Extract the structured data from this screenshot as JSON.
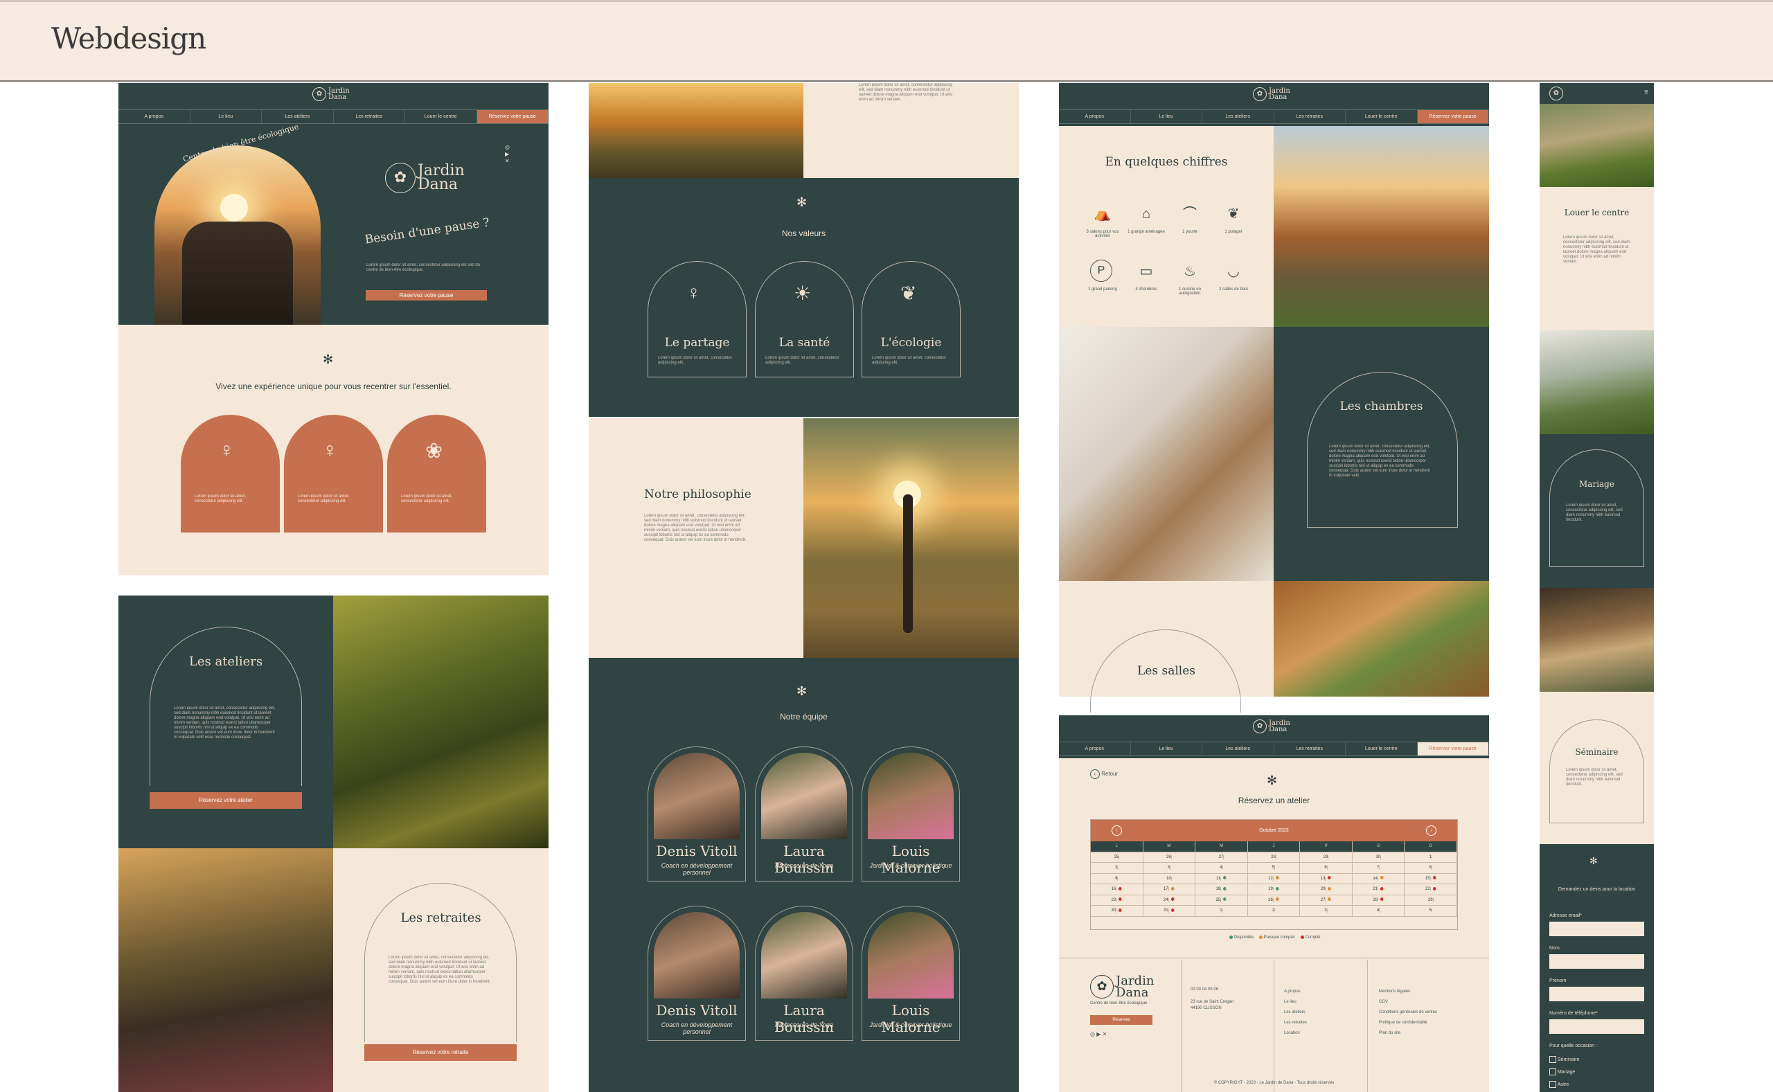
{
  "header": {
    "title": "Webdesign"
  },
  "colors": {
    "dark": "#2f4443",
    "cream": "#f5e8d9",
    "terracotta": "#c7704f",
    "header_bg": "#f5ebe1"
  },
  "nav": {
    "items": [
      "A propos",
      "Le lieu",
      "Les ateliers",
      "Les retraites",
      "Louer le centre",
      "Réservez votre pause"
    ]
  },
  "logo": {
    "line1": "Jardin",
    "line2": "Dana",
    "tagline": "Centre de bien-être écologique"
  },
  "col1": {
    "hero_arc_text": "Centre de bien être écologique",
    "hero_title": "Besoin d'une pause ?",
    "hero_button": "Réservez votre pause",
    "intro_text": "Vivez une expérience unique pour vous recentrer sur l'essentiel.",
    "ateliers_title": "Les ateliers",
    "ateliers_button": "Réservez votre atelier",
    "retraites_title": "Les retraites",
    "retraites_button": "Réservez votre retraite"
  },
  "col2": {
    "values_title": "Nos valeurs",
    "values": [
      "Le partage",
      "La santé",
      "L'écologie"
    ],
    "philo_title": "Notre philosophie",
    "team_title": "Notre équipe",
    "team": [
      {
        "name": "Denis Vitoll",
        "role": "Coach en développement personnel"
      },
      {
        "name": "Laura Bouissin",
        "role": "Professeure de Yoga"
      },
      {
        "name": "Louis Malorne",
        "role": "Jardinier & cuisinier holistique"
      },
      {
        "name": "Denis Vitoll",
        "role": "Coach en développement personnel"
      },
      {
        "name": "Laura Bouissin",
        "role": "Professeure de Yoga"
      },
      {
        "name": "Louis Malorne",
        "role": "Jardinier & cuisinier holistique"
      }
    ]
  },
  "col3": {
    "figures_title": "En quelques chiffres",
    "figures": [
      "3 salons pour vos activités",
      "1 grange aménagée",
      "1 yourte",
      "1 potager",
      "1 grand parking",
      "4 chambres",
      "1 cuisine en autogestion",
      "2 salles de bain"
    ],
    "figure_icons": [
      "tent-icon",
      "barn-icon",
      "yurt-icon",
      "plant-icon",
      "parking-icon",
      "bed-icon",
      "chef-hat-icon",
      "bath-icon"
    ],
    "rooms_title": "Les chambres",
    "halls_title": "Les salles",
    "booking_back": "Retour",
    "booking_title": "Réservez un atelier",
    "calendar_month": "Octobre 2023",
    "calendar_days": [
      "L",
      "M",
      "M",
      "J",
      "V",
      "S",
      "D"
    ],
    "calendar_rows": [
      [
        "25",
        "26",
        "27",
        "28",
        "29",
        "30",
        "1"
      ],
      [
        "2",
        "3",
        "4",
        "5",
        "6",
        "7",
        "8"
      ],
      [
        "9",
        "10",
        "11",
        "12",
        "13",
        "14",
        "15"
      ],
      [
        "16",
        "17",
        "18",
        "19",
        "20",
        "21",
        "22"
      ],
      [
        "23",
        "24",
        "25",
        "26",
        "27",
        "28",
        "29"
      ],
      [
        "30",
        "31",
        "1",
        "2",
        "3",
        "4",
        "5"
      ]
    ],
    "legend": [
      "Disponible",
      "Presque complet",
      "Complet"
    ],
    "footer_button": "Réservez",
    "footer_phone": "02 03 04 05 06",
    "footer_address1": "23 rue de Saint Cregan",
    "footer_address2": "44190 CLISSON",
    "footer_links1": [
      "A propos",
      "Le lieu",
      "Les ateliers",
      "Les retraites",
      "Location"
    ],
    "footer_links2": [
      "Mentions légales",
      "CGV",
      "Conditions générales de ventes",
      "Politique de confidentialité",
      "Plan du site"
    ],
    "copyright": "© COPYRIGHT - 2023 - Le Jardin de Dana - Tous droits réservés"
  },
  "col4": {
    "rent_title": "Louer le centre",
    "wedding_title": "Mariage",
    "seminar_title": "Séminaire",
    "form_title": "Demandez un devis pour la location",
    "fields": [
      "Adresse email*",
      "Nom",
      "Prénom",
      "Numéro de téléphone*"
    ],
    "occasion_label": "Pour quelle occasion :",
    "occasions": [
      "Séminaire",
      "Mariage",
      "Autre"
    ]
  }
}
